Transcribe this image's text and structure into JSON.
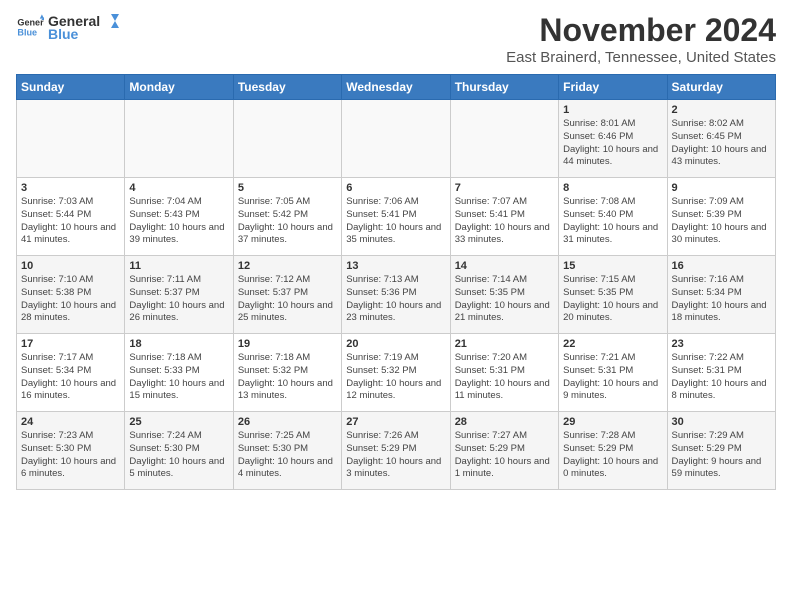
{
  "header": {
    "logo_general": "General",
    "logo_blue": "Blue",
    "month": "November 2024",
    "location": "East Brainerd, Tennessee, United States"
  },
  "weekdays": [
    "Sunday",
    "Monday",
    "Tuesday",
    "Wednesday",
    "Thursday",
    "Friday",
    "Saturday"
  ],
  "weeks": [
    [
      {
        "day": "",
        "info": ""
      },
      {
        "day": "",
        "info": ""
      },
      {
        "day": "",
        "info": ""
      },
      {
        "day": "",
        "info": ""
      },
      {
        "day": "",
        "info": ""
      },
      {
        "day": "1",
        "info": "Sunrise: 8:01 AM\nSunset: 6:46 PM\nDaylight: 10 hours and 44 minutes."
      },
      {
        "day": "2",
        "info": "Sunrise: 8:02 AM\nSunset: 6:45 PM\nDaylight: 10 hours and 43 minutes."
      }
    ],
    [
      {
        "day": "3",
        "info": "Sunrise: 7:03 AM\nSunset: 5:44 PM\nDaylight: 10 hours and 41 minutes."
      },
      {
        "day": "4",
        "info": "Sunrise: 7:04 AM\nSunset: 5:43 PM\nDaylight: 10 hours and 39 minutes."
      },
      {
        "day": "5",
        "info": "Sunrise: 7:05 AM\nSunset: 5:42 PM\nDaylight: 10 hours and 37 minutes."
      },
      {
        "day": "6",
        "info": "Sunrise: 7:06 AM\nSunset: 5:41 PM\nDaylight: 10 hours and 35 minutes."
      },
      {
        "day": "7",
        "info": "Sunrise: 7:07 AM\nSunset: 5:41 PM\nDaylight: 10 hours and 33 minutes."
      },
      {
        "day": "8",
        "info": "Sunrise: 7:08 AM\nSunset: 5:40 PM\nDaylight: 10 hours and 31 minutes."
      },
      {
        "day": "9",
        "info": "Sunrise: 7:09 AM\nSunset: 5:39 PM\nDaylight: 10 hours and 30 minutes."
      }
    ],
    [
      {
        "day": "10",
        "info": "Sunrise: 7:10 AM\nSunset: 5:38 PM\nDaylight: 10 hours and 28 minutes."
      },
      {
        "day": "11",
        "info": "Sunrise: 7:11 AM\nSunset: 5:37 PM\nDaylight: 10 hours and 26 minutes."
      },
      {
        "day": "12",
        "info": "Sunrise: 7:12 AM\nSunset: 5:37 PM\nDaylight: 10 hours and 25 minutes."
      },
      {
        "day": "13",
        "info": "Sunrise: 7:13 AM\nSunset: 5:36 PM\nDaylight: 10 hours and 23 minutes."
      },
      {
        "day": "14",
        "info": "Sunrise: 7:14 AM\nSunset: 5:35 PM\nDaylight: 10 hours and 21 minutes."
      },
      {
        "day": "15",
        "info": "Sunrise: 7:15 AM\nSunset: 5:35 PM\nDaylight: 10 hours and 20 minutes."
      },
      {
        "day": "16",
        "info": "Sunrise: 7:16 AM\nSunset: 5:34 PM\nDaylight: 10 hours and 18 minutes."
      }
    ],
    [
      {
        "day": "17",
        "info": "Sunrise: 7:17 AM\nSunset: 5:34 PM\nDaylight: 10 hours and 16 minutes."
      },
      {
        "day": "18",
        "info": "Sunrise: 7:18 AM\nSunset: 5:33 PM\nDaylight: 10 hours and 15 minutes."
      },
      {
        "day": "19",
        "info": "Sunrise: 7:18 AM\nSunset: 5:32 PM\nDaylight: 10 hours and 13 minutes."
      },
      {
        "day": "20",
        "info": "Sunrise: 7:19 AM\nSunset: 5:32 PM\nDaylight: 10 hours and 12 minutes."
      },
      {
        "day": "21",
        "info": "Sunrise: 7:20 AM\nSunset: 5:31 PM\nDaylight: 10 hours and 11 minutes."
      },
      {
        "day": "22",
        "info": "Sunrise: 7:21 AM\nSunset: 5:31 PM\nDaylight: 10 hours and 9 minutes."
      },
      {
        "day": "23",
        "info": "Sunrise: 7:22 AM\nSunset: 5:31 PM\nDaylight: 10 hours and 8 minutes."
      }
    ],
    [
      {
        "day": "24",
        "info": "Sunrise: 7:23 AM\nSunset: 5:30 PM\nDaylight: 10 hours and 6 minutes."
      },
      {
        "day": "25",
        "info": "Sunrise: 7:24 AM\nSunset: 5:30 PM\nDaylight: 10 hours and 5 minutes."
      },
      {
        "day": "26",
        "info": "Sunrise: 7:25 AM\nSunset: 5:30 PM\nDaylight: 10 hours and 4 minutes."
      },
      {
        "day": "27",
        "info": "Sunrise: 7:26 AM\nSunset: 5:29 PM\nDaylight: 10 hours and 3 minutes."
      },
      {
        "day": "28",
        "info": "Sunrise: 7:27 AM\nSunset: 5:29 PM\nDaylight: 10 hours and 1 minute."
      },
      {
        "day": "29",
        "info": "Sunrise: 7:28 AM\nSunset: 5:29 PM\nDaylight: 10 hours and 0 minutes."
      },
      {
        "day": "30",
        "info": "Sunrise: 7:29 AM\nSunset: 5:29 PM\nDaylight: 9 hours and 59 minutes."
      }
    ]
  ]
}
